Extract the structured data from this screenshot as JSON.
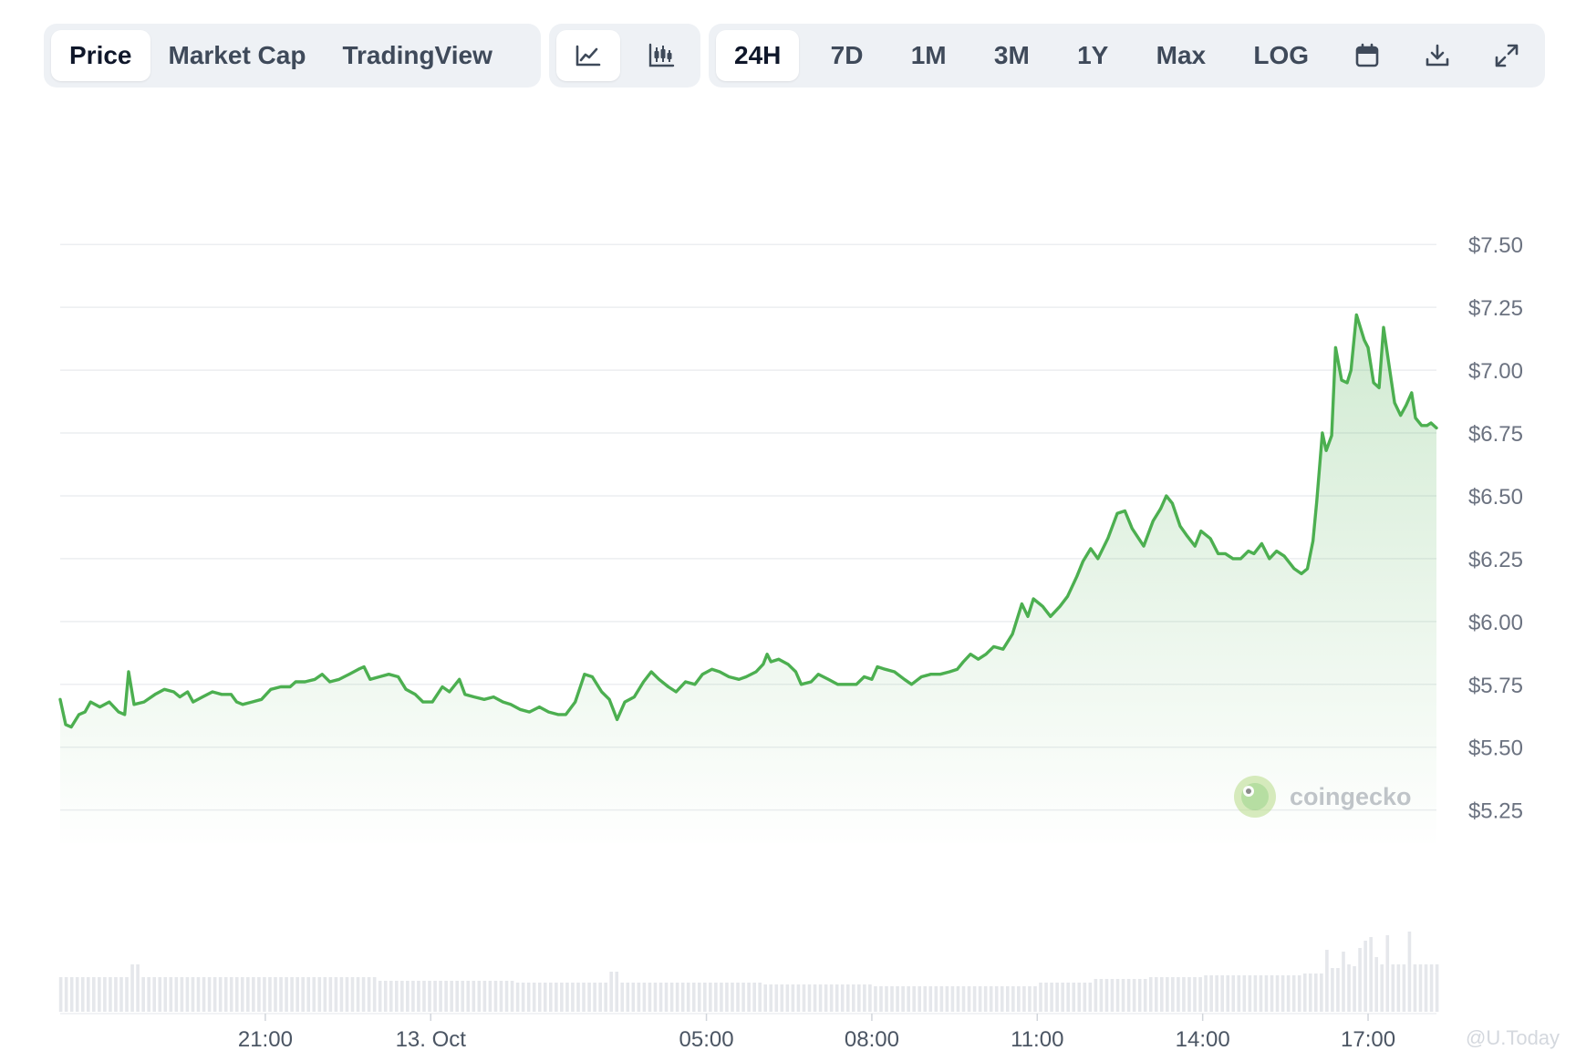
{
  "tabs": {
    "view": [
      {
        "id": "price",
        "label": "Price",
        "active": true
      },
      {
        "id": "market-cap",
        "label": "Market Cap",
        "active": false
      },
      {
        "id": "tradingview",
        "label": "TradingView",
        "active": false
      }
    ],
    "chart_style": [
      {
        "id": "line",
        "icon": "line-chart-icon",
        "active": true
      },
      {
        "id": "candle",
        "icon": "candlestick-icon",
        "active": false
      }
    ],
    "range": [
      {
        "id": "24h",
        "label": "24H",
        "active": true
      },
      {
        "id": "7d",
        "label": "7D",
        "active": false
      },
      {
        "id": "1m",
        "label": "1M",
        "active": false
      },
      {
        "id": "3m",
        "label": "3M",
        "active": false
      },
      {
        "id": "1y",
        "label": "1Y",
        "active": false
      },
      {
        "id": "max",
        "label": "Max",
        "active": false
      },
      {
        "id": "log",
        "label": "LOG",
        "active": false
      }
    ],
    "actions": [
      {
        "id": "calendar",
        "icon": "calendar-icon"
      },
      {
        "id": "download",
        "icon": "download-icon"
      },
      {
        "id": "expand",
        "icon": "expand-icon"
      }
    ]
  },
  "branding": {
    "name": "coingecko",
    "watermark": "@U.Today"
  },
  "colors": {
    "line": "#4caf50",
    "area_top": "#dff2e1",
    "grid": "#eceef1",
    "volume": "#e5e7eb",
    "axis_text": "#6b7280"
  },
  "chart_data": {
    "type": "area",
    "x_unit": "hours",
    "xlim": [
      -6.72,
      17.05
    ],
    "ylim": [
      5.1,
      7.82
    ],
    "y_ticks": [
      {
        "value": 7.5,
        "label": "$7.50"
      },
      {
        "value": 7.25,
        "label": "$7.25"
      },
      {
        "value": 7.0,
        "label": "$7.00"
      },
      {
        "value": 6.75,
        "label": "$6.75"
      },
      {
        "value": 6.5,
        "label": "$6.50"
      },
      {
        "value": 6.25,
        "label": "$6.25"
      },
      {
        "value": 6.0,
        "label": "$6.00"
      },
      {
        "value": 5.75,
        "label": "$5.75"
      },
      {
        "value": 5.5,
        "label": "$5.50"
      },
      {
        "value": 5.25,
        "label": "$5.25"
      }
    ],
    "x_ticks": [
      {
        "value": -3.0,
        "label": "21:00"
      },
      {
        "value": 0.0,
        "label": "13. Oct"
      },
      {
        "value": 5.0,
        "label": "05:00"
      },
      {
        "value": 8.0,
        "label": "08:00"
      },
      {
        "value": 11.0,
        "label": "11:00"
      },
      {
        "value": 14.0,
        "label": "14:00"
      },
      {
        "value": 17.0,
        "label": "17:00"
      }
    ],
    "price": [
      [
        -6.72,
        5.69
      ],
      [
        -6.62,
        5.59
      ],
      [
        -6.52,
        5.58
      ],
      [
        -6.38,
        5.63
      ],
      [
        -6.27,
        5.64
      ],
      [
        -6.17,
        5.68
      ],
      [
        -6.0,
        5.66
      ],
      [
        -5.83,
        5.68
      ],
      [
        -5.66,
        5.64
      ],
      [
        -5.55,
        5.63
      ],
      [
        -5.48,
        5.8
      ],
      [
        -5.38,
        5.67
      ],
      [
        -5.2,
        5.68
      ],
      [
        -5.0,
        5.71
      ],
      [
        -4.83,
        5.73
      ],
      [
        -4.66,
        5.72
      ],
      [
        -4.55,
        5.7
      ],
      [
        -4.41,
        5.72
      ],
      [
        -4.31,
        5.68
      ],
      [
        -4.14,
        5.7
      ],
      [
        -3.96,
        5.72
      ],
      [
        -3.79,
        5.71
      ],
      [
        -3.62,
        5.71
      ],
      [
        -3.52,
        5.68
      ],
      [
        -3.41,
        5.67
      ],
      [
        -3.24,
        5.68
      ],
      [
        -3.07,
        5.69
      ],
      [
        -2.9,
        5.73
      ],
      [
        -2.72,
        5.74
      ],
      [
        -2.55,
        5.74
      ],
      [
        -2.45,
        5.76
      ],
      [
        -2.28,
        5.76
      ],
      [
        -2.1,
        5.77
      ],
      [
        -1.97,
        5.79
      ],
      [
        -1.83,
        5.76
      ],
      [
        -1.66,
        5.77
      ],
      [
        -1.48,
        5.79
      ],
      [
        -1.31,
        5.81
      ],
      [
        -1.21,
        5.82
      ],
      [
        -1.1,
        5.77
      ],
      [
        -0.93,
        5.78
      ],
      [
        -0.76,
        5.79
      ],
      [
        -0.59,
        5.78
      ],
      [
        -0.45,
        5.73
      ],
      [
        -0.28,
        5.71
      ],
      [
        -0.14,
        5.68
      ],
      [
        0.03,
        5.68
      ],
      [
        0.21,
        5.74
      ],
      [
        0.34,
        5.72
      ],
      [
        0.52,
        5.77
      ],
      [
        0.62,
        5.71
      ],
      [
        0.79,
        5.7
      ],
      [
        0.97,
        5.69
      ],
      [
        1.14,
        5.7
      ],
      [
        1.31,
        5.68
      ],
      [
        1.45,
        5.67
      ],
      [
        1.62,
        5.65
      ],
      [
        1.79,
        5.64
      ],
      [
        1.97,
        5.66
      ],
      [
        2.14,
        5.64
      ],
      [
        2.31,
        5.63
      ],
      [
        2.45,
        5.63
      ],
      [
        2.62,
        5.68
      ],
      [
        2.79,
        5.79
      ],
      [
        2.93,
        5.78
      ],
      [
        3.1,
        5.72
      ],
      [
        3.24,
        5.69
      ],
      [
        3.38,
        5.61
      ],
      [
        3.52,
        5.68
      ],
      [
        3.69,
        5.7
      ],
      [
        3.86,
        5.76
      ],
      [
        4.0,
        5.8
      ],
      [
        4.14,
        5.77
      ],
      [
        4.31,
        5.74
      ],
      [
        4.45,
        5.72
      ],
      [
        4.62,
        5.76
      ],
      [
        4.79,
        5.75
      ],
      [
        4.93,
        5.79
      ],
      [
        5.1,
        5.81
      ],
      [
        5.24,
        5.8
      ],
      [
        5.41,
        5.78
      ],
      [
        5.59,
        5.77
      ],
      [
        5.72,
        5.78
      ],
      [
        5.9,
        5.8
      ],
      [
        6.03,
        5.83
      ],
      [
        6.1,
        5.87
      ],
      [
        6.17,
        5.84
      ],
      [
        6.31,
        5.85
      ],
      [
        6.48,
        5.83
      ],
      [
        6.62,
        5.8
      ],
      [
        6.72,
        5.75
      ],
      [
        6.9,
        5.76
      ],
      [
        7.03,
        5.79
      ],
      [
        7.21,
        5.77
      ],
      [
        7.38,
        5.75
      ],
      [
        7.55,
        5.75
      ],
      [
        7.72,
        5.75
      ],
      [
        7.86,
        5.78
      ],
      [
        8.0,
        5.77
      ],
      [
        8.1,
        5.82
      ],
      [
        8.24,
        5.81
      ],
      [
        8.41,
        5.8
      ],
      [
        8.59,
        5.77
      ],
      [
        8.72,
        5.75
      ],
      [
        8.9,
        5.78
      ],
      [
        9.07,
        5.79
      ],
      [
        9.24,
        5.79
      ],
      [
        9.41,
        5.8
      ],
      [
        9.55,
        5.81
      ],
      [
        9.66,
        5.84
      ],
      [
        9.79,
        5.87
      ],
      [
        9.93,
        5.85
      ],
      [
        10.07,
        5.87
      ],
      [
        10.21,
        5.9
      ],
      [
        10.38,
        5.89
      ],
      [
        10.55,
        5.95
      ],
      [
        10.72,
        6.07
      ],
      [
        10.83,
        6.02
      ],
      [
        10.93,
        6.09
      ],
      [
        11.1,
        6.06
      ],
      [
        11.24,
        6.02
      ],
      [
        11.41,
        6.06
      ],
      [
        11.55,
        6.1
      ],
      [
        11.72,
        6.18
      ],
      [
        11.83,
        6.24
      ],
      [
        11.97,
        6.29
      ],
      [
        12.1,
        6.25
      ],
      [
        12.28,
        6.33
      ],
      [
        12.45,
        6.43
      ],
      [
        12.59,
        6.44
      ],
      [
        12.72,
        6.37
      ],
      [
        12.93,
        6.3
      ],
      [
        13.1,
        6.4
      ],
      [
        13.24,
        6.45
      ],
      [
        13.34,
        6.5
      ],
      [
        13.45,
        6.47
      ],
      [
        13.59,
        6.38
      ],
      [
        13.72,
        6.34
      ],
      [
        13.86,
        6.3
      ],
      [
        13.97,
        6.36
      ],
      [
        14.14,
        6.33
      ],
      [
        14.28,
        6.27
      ],
      [
        14.41,
        6.27
      ],
      [
        14.55,
        6.25
      ],
      [
        14.69,
        6.25
      ],
      [
        14.83,
        6.28
      ],
      [
        14.93,
        6.27
      ],
      [
        15.07,
        6.31
      ],
      [
        15.21,
        6.25
      ],
      [
        15.34,
        6.28
      ],
      [
        15.48,
        6.26
      ],
      [
        15.66,
        6.21
      ],
      [
        15.79,
        6.19
      ],
      [
        15.9,
        6.21
      ],
      [
        16.0,
        6.32
      ],
      [
        16.07,
        6.48
      ],
      [
        16.17,
        6.75
      ],
      [
        16.24,
        6.68
      ],
      [
        16.34,
        6.74
      ],
      [
        16.41,
        7.09
      ],
      [
        16.52,
        6.96
      ],
      [
        16.62,
        6.95
      ],
      [
        16.69,
        7.0
      ],
      [
        16.79,
        7.22
      ],
      [
        16.93,
        7.12
      ],
      [
        17.0,
        7.09
      ],
      [
        17.1,
        6.95
      ],
      [
        17.2,
        6.93
      ],
      [
        17.28,
        7.17
      ],
      [
        17.38,
        7.02
      ],
      [
        17.48,
        6.87
      ],
      [
        17.59,
        6.82
      ],
      [
        17.69,
        6.86
      ],
      [
        17.79,
        6.91
      ],
      [
        17.86,
        6.81
      ],
      [
        17.97,
        6.78
      ],
      [
        18.07,
        6.78
      ],
      [
        18.14,
        6.79
      ],
      [
        18.24,
        6.77
      ]
    ],
    "volume_levels": [
      [
        -6.72,
        0.19
      ],
      [
        -6.0,
        0.19
      ],
      [
        -5.48,
        0.26
      ],
      [
        -5.3,
        0.19
      ],
      [
        -3.5,
        0.19
      ],
      [
        -3.3,
        0.19
      ],
      [
        -1.0,
        0.17
      ],
      [
        0.0,
        0.17
      ],
      [
        1.5,
        0.16
      ],
      [
        3.0,
        0.16
      ],
      [
        3.24,
        0.22
      ],
      [
        3.38,
        0.16
      ],
      [
        5.0,
        0.16
      ],
      [
        6.0,
        0.15
      ],
      [
        7.0,
        0.15
      ],
      [
        8.0,
        0.14
      ],
      [
        9.0,
        0.14
      ],
      [
        10.0,
        0.14
      ],
      [
        11.0,
        0.16
      ],
      [
        12.0,
        0.18
      ],
      [
        13.0,
        0.19
      ],
      [
        14.0,
        0.2
      ],
      [
        15.0,
        0.2
      ],
      [
        15.8,
        0.21
      ],
      [
        16.1,
        0.21
      ],
      [
        16.2,
        0.34
      ],
      [
        16.3,
        0.24
      ],
      [
        16.45,
        0.33
      ],
      [
        16.55,
        0.26
      ],
      [
        16.7,
        0.25
      ],
      [
        16.8,
        0.35
      ],
      [
        16.9,
        0.39
      ],
      [
        17.0,
        0.41
      ],
      [
        17.1,
        0.3
      ],
      [
        17.2,
        0.26
      ],
      [
        17.3,
        0.42
      ],
      [
        17.4,
        0.26
      ],
      [
        17.6,
        0.26
      ],
      [
        17.7,
        0.44
      ],
      [
        17.8,
        0.26
      ],
      [
        18.24,
        0.26
      ]
    ]
  }
}
